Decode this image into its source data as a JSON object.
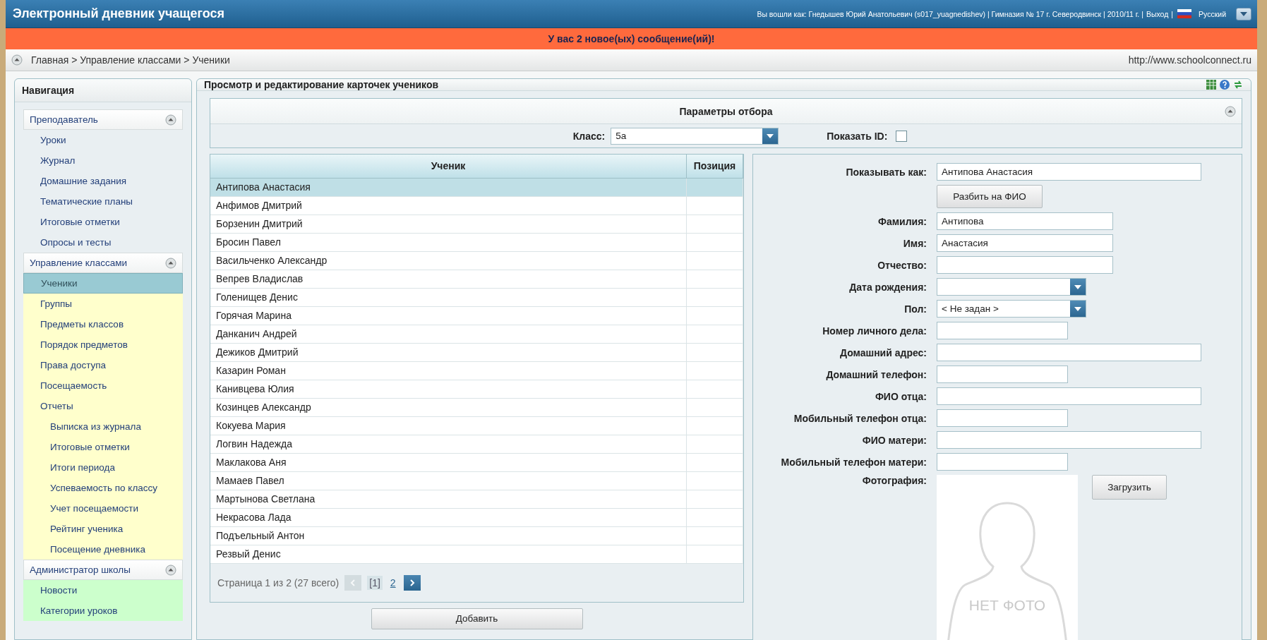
{
  "header": {
    "title": "Электронный дневник учащегося",
    "user_info": "Вы вошли как: Гнедышев Юрий Анатольевич (s017_yuagnedishev) | Гимназия № 17 г. Северодвинск | 2010/11 г. |",
    "logout": "Выход",
    "separator": "|",
    "language": "Русский"
  },
  "notice": "У вас 2 новое(ых) сообщение(ий)!",
  "breadcrumb": {
    "path": "Главная > Управление классами > Ученики",
    "site": "http://www.schoolconnect.ru"
  },
  "navigation": {
    "title": "Навигация",
    "groups": [
      {
        "label": "Преподаватель",
        "expanded": true,
        "color": "#e9eff2",
        "items": [
          {
            "label": "Уроки",
            "selected": false
          },
          {
            "label": "Журнал",
            "selected": false
          },
          {
            "label": "Домашние задания",
            "selected": false
          },
          {
            "label": "Тематические планы",
            "selected": false
          },
          {
            "label": "Итоговые отметки",
            "selected": false
          },
          {
            "label": "Опросы и тесты",
            "selected": false
          }
        ]
      },
      {
        "label": "Управление классами",
        "expanded": true,
        "color": "#ffffcc",
        "items": [
          {
            "label": "Ученики",
            "selected": true
          },
          {
            "label": "Группы",
            "selected": false
          },
          {
            "label": "Предметы классов",
            "selected": false
          },
          {
            "label": "Порядок предметов",
            "selected": false
          },
          {
            "label": "Права доступа",
            "selected": false
          },
          {
            "label": "Посещаемость",
            "selected": false
          },
          {
            "label": "Отчеты",
            "selected": false,
            "children": [
              {
                "label": "Выписка из журнала",
                "selected": false
              },
              {
                "label": "Итоговые отметки",
                "selected": false
              },
              {
                "label": "Итоги периода",
                "selected": false
              },
              {
                "label": "Успеваемость по классу",
                "selected": false
              },
              {
                "label": "Учет посещаемости",
                "selected": false
              },
              {
                "label": "Рейтинг ученика",
                "selected": false
              },
              {
                "label": "Посещение дневника",
                "selected": false
              }
            ]
          }
        ]
      },
      {
        "label": "Администратор школы",
        "expanded": true,
        "color": "#ccffcc",
        "items": [
          {
            "label": "Новости",
            "selected": false
          },
          {
            "label": "Категории уроков",
            "selected": false
          }
        ]
      }
    ]
  },
  "main": {
    "title": "Просмотр и редактирование карточек учеников",
    "filter": {
      "title": "Параметры отбора",
      "expanded": true,
      "class_label": "Класс:",
      "class_value": "5а",
      "show_id_label": "Показать ID:",
      "show_id_checked": false
    },
    "table": {
      "columns": [
        "Ученик",
        "Позиция"
      ],
      "rows": [
        {
          "name": "Антипова Анастасия",
          "selected": true
        },
        {
          "name": "Анфимов Дмитрий",
          "selected": false
        },
        {
          "name": "Борзенин Дмитрий",
          "selected": false
        },
        {
          "name": "Бросин Павел",
          "selected": false
        },
        {
          "name": "Васильченко Александр",
          "selected": false
        },
        {
          "name": "Вепрев Владислав",
          "selected": false
        },
        {
          "name": "Голенищев Денис",
          "selected": false
        },
        {
          "name": "Горячая Марина",
          "selected": false
        },
        {
          "name": "Данканич Андрей",
          "selected": false
        },
        {
          "name": "Дежиков Дмитрий",
          "selected": false
        },
        {
          "name": "Казарин Роман",
          "selected": false
        },
        {
          "name": "Канивцева Юлия",
          "selected": false
        },
        {
          "name": "Козинцев Александр",
          "selected": false
        },
        {
          "name": "Кокуева Мария",
          "selected": false
        },
        {
          "name": "Логвин Надежда",
          "selected": false
        },
        {
          "name": "Маклакова Аня",
          "selected": false
        },
        {
          "name": "Мамаев Павел",
          "selected": false
        },
        {
          "name": "Мартынова Светлана",
          "selected": false
        },
        {
          "name": "Некрасова Лада",
          "selected": false
        },
        {
          "name": "Подъельный Антон",
          "selected": false
        },
        {
          "name": "Резвый Денис",
          "selected": false
        }
      ]
    },
    "pager": {
      "summary": "Страница 1 из 2 (27 всего)",
      "prev_disabled": true,
      "pages": [
        {
          "label": "[1]",
          "selected": true
        },
        {
          "label": "2",
          "selected": false
        }
      ]
    },
    "add_button": "Добавить",
    "form": [
      {
        "kind": "wide_field",
        "label": "Показывать как:",
        "value": "Антипова Анастасия"
      },
      {
        "kind": "button",
        "text": "Разбить на ФИО"
      },
      {
        "kind": "field",
        "label": "Фамилия:",
        "value": "Антипова"
      },
      {
        "kind": "field",
        "label": "Имя:",
        "value": "Анастасия"
      },
      {
        "kind": "field",
        "label": "Отчество:"
      },
      {
        "kind": "dropdown",
        "label": "Дата рождения:"
      },
      {
        "kind": "dropdown",
        "label": "Пол:",
        "value": "< Не задан >"
      },
      {
        "kind": "short_field",
        "label": "Номер личного дела:"
      },
      {
        "kind": "wide_field",
        "label": "Домашний адрес:"
      },
      {
        "kind": "short_field",
        "label": "Домашний телефон:"
      },
      {
        "kind": "wide_field",
        "label": "ФИО отца:"
      },
      {
        "kind": "short_field",
        "label": "Мобильный телефон отца:"
      },
      {
        "kind": "wide_field",
        "label": "ФИО матери:"
      },
      {
        "kind": "short_field",
        "label": "Мобильный телефон матери:"
      },
      {
        "kind": "photo",
        "label": "Фотография:",
        "caption": "НЕТ ФОТО",
        "button": "Загрузить"
      }
    ]
  }
}
